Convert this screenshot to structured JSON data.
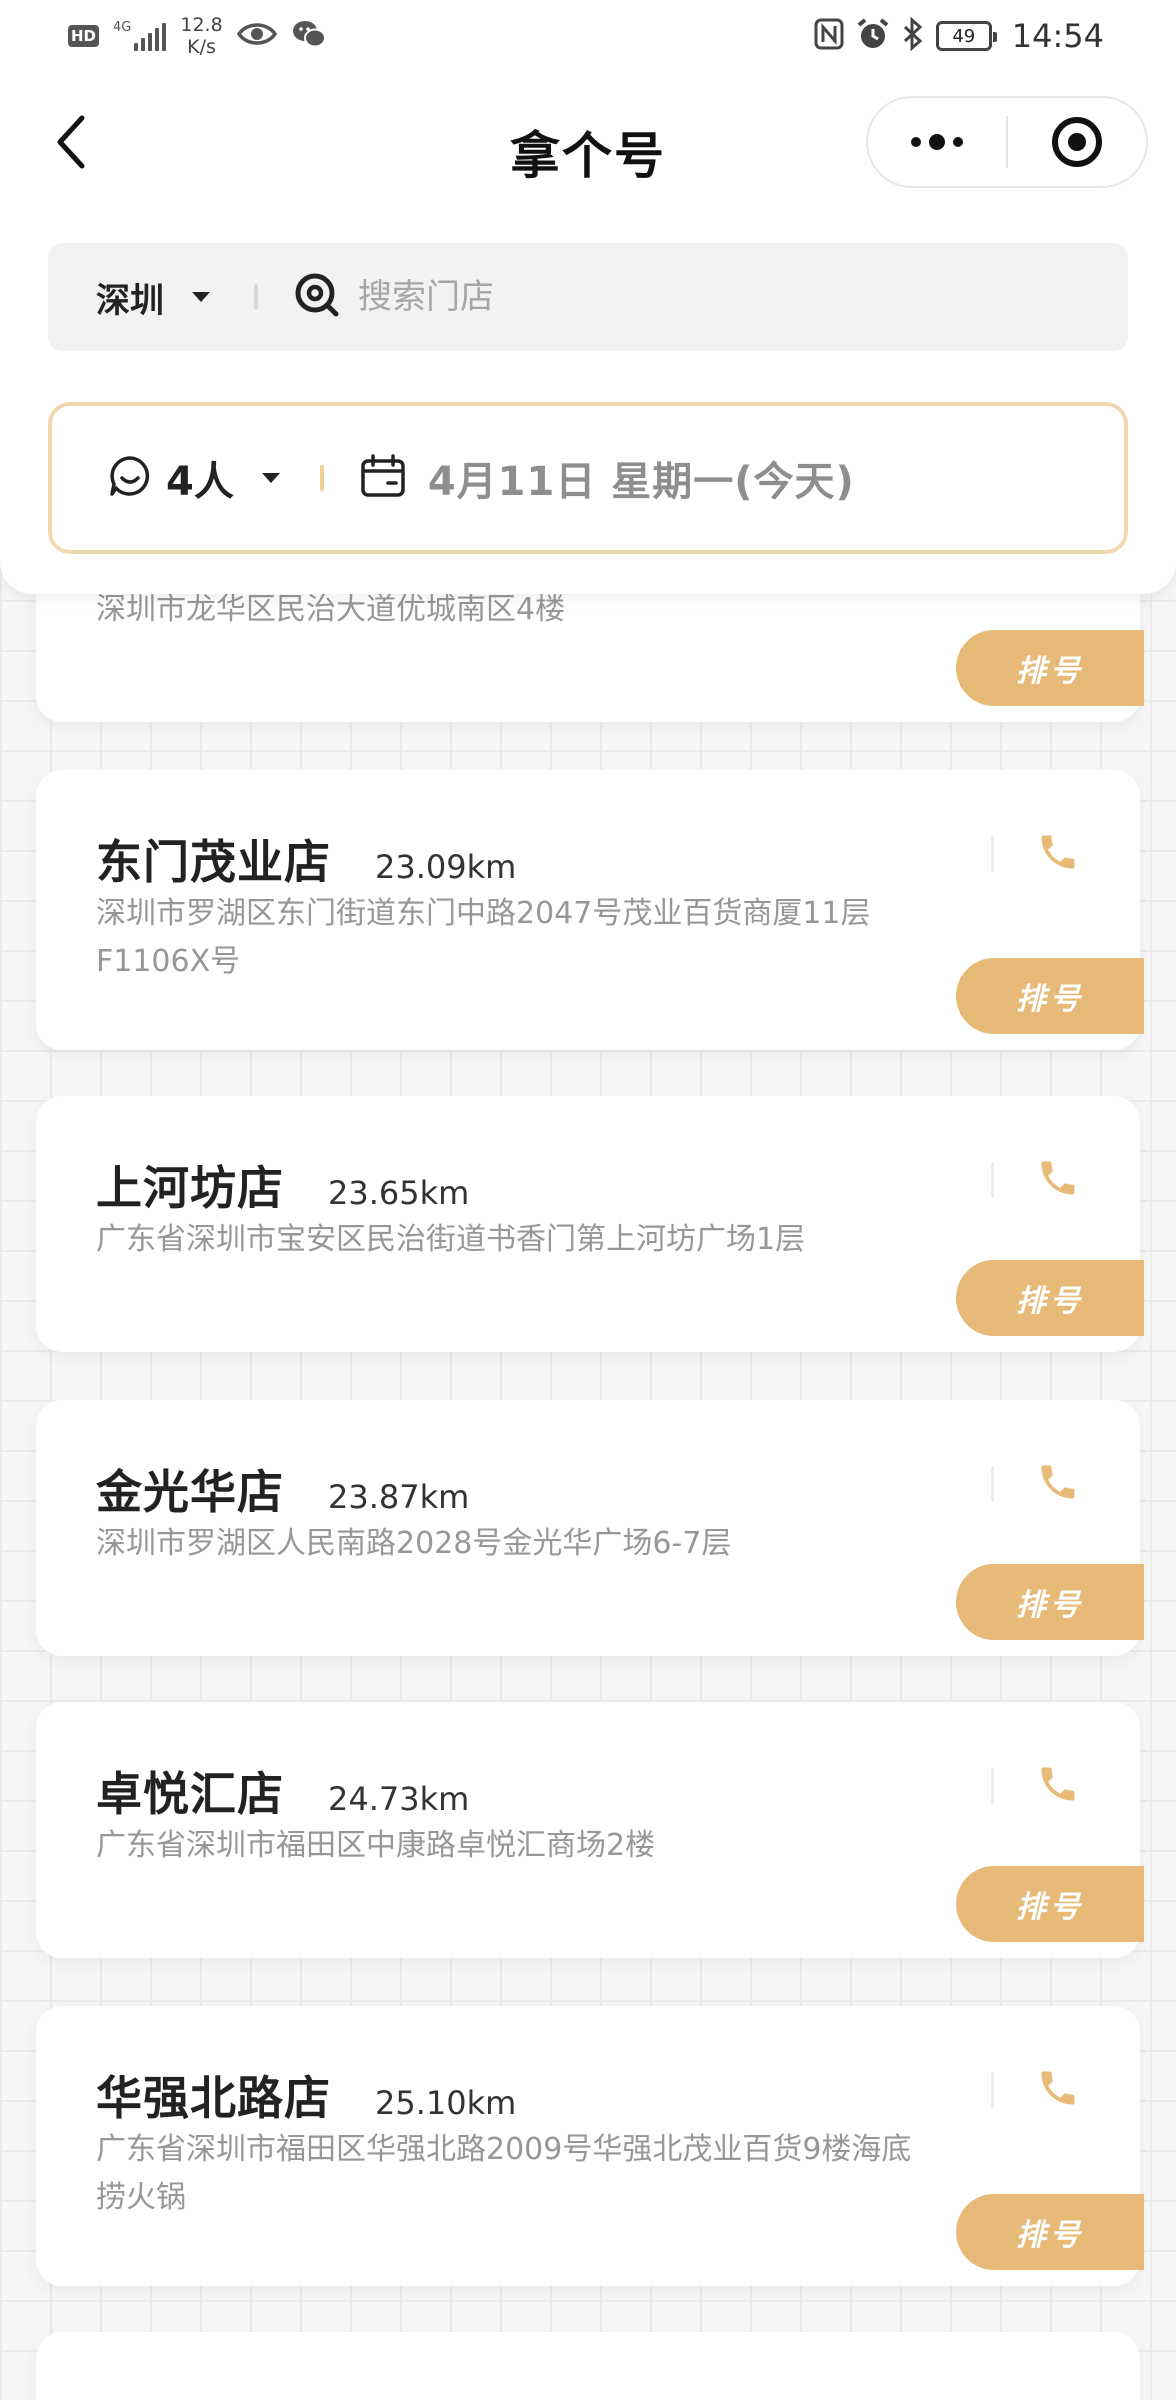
{
  "status_bar": {
    "hd": "HD",
    "network": "4G",
    "speed_value": "12.8",
    "speed_unit": "K/s",
    "battery": "49",
    "time": "14:54"
  },
  "nav": {
    "title": "拿个号"
  },
  "search": {
    "city": "深圳",
    "placeholder": "搜索门店"
  },
  "filter": {
    "party_size": "4人",
    "date": "4月11日 星期一(今天)"
  },
  "queue_label": "排号",
  "colors": {
    "accent": "#e7ba78",
    "accent_border": "#f2d8ae"
  },
  "stores": [
    {
      "name": "",
      "distance": "",
      "address": "深圳市龙华区民治大道优城南区4楼"
    },
    {
      "name": "东门茂业店",
      "distance": "23.09km",
      "address": "深圳市罗湖区东门街道东门中路2047号茂业百货商厦11层F1106X号"
    },
    {
      "name": "上河坊店",
      "distance": "23.65km",
      "address": "广东省深圳市宝安区民治街道书香门第上河坊广场1层"
    },
    {
      "name": "金光华店",
      "distance": "23.87km",
      "address": "深圳市罗湖区人民南路2028号金光华广场6-7层"
    },
    {
      "name": "卓悦汇店",
      "distance": "24.73km",
      "address": "广东省深圳市福田区中康路卓悦汇商场2楼"
    },
    {
      "name": "华强北路店",
      "distance": "25.10km",
      "address": "广东省深圳市福田区华强北路2009号华强北茂业百货9楼海底捞火锅"
    }
  ]
}
